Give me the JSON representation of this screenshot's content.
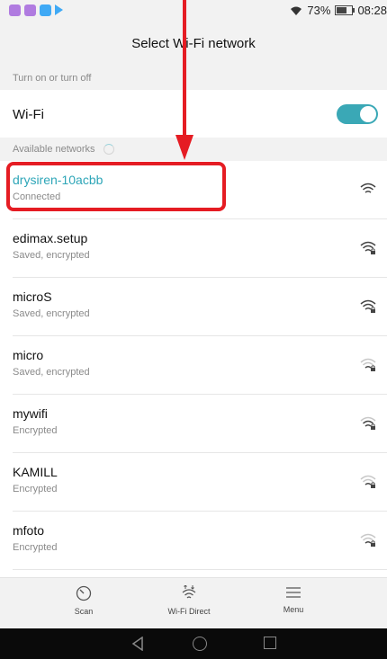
{
  "status_bar": {
    "icons": [
      "gallery-icon",
      "app-icon",
      "chat-icon",
      "play-icon"
    ],
    "battery": "73%",
    "time": "08:28"
  },
  "header": {
    "title": "Select Wi-Fi network"
  },
  "section_toggle": {
    "label": "Turn on or turn off"
  },
  "wifi_toggle": {
    "label": "Wi-Fi",
    "state": "on"
  },
  "section_available": {
    "label": "Available networks"
  },
  "networks": [
    {
      "name": "drysiren-10acbb",
      "status": "Connected",
      "signal": "strong"
    },
    {
      "name": "edimax.setup",
      "status": "Saved, encrypted",
      "signal": "strong-locked"
    },
    {
      "name": "microS",
      "status": "Saved, encrypted",
      "signal": "strong-locked"
    },
    {
      "name": "micro",
      "status": "Saved, encrypted",
      "signal": "weak-locked"
    },
    {
      "name": "mywifi",
      "status": "Encrypted",
      "signal": "medium-locked"
    },
    {
      "name": "KAMILL",
      "status": "Encrypted",
      "signal": "weak-locked"
    },
    {
      "name": "mfoto",
      "status": "Encrypted",
      "signal": "weak-locked"
    }
  ],
  "bottom_bar": {
    "scan": "Scan",
    "wifi_direct": "Wi-Fi Direct",
    "menu": "Menu"
  },
  "colors": {
    "accent": "#2ea6b8",
    "annotation": "#e51c23"
  }
}
